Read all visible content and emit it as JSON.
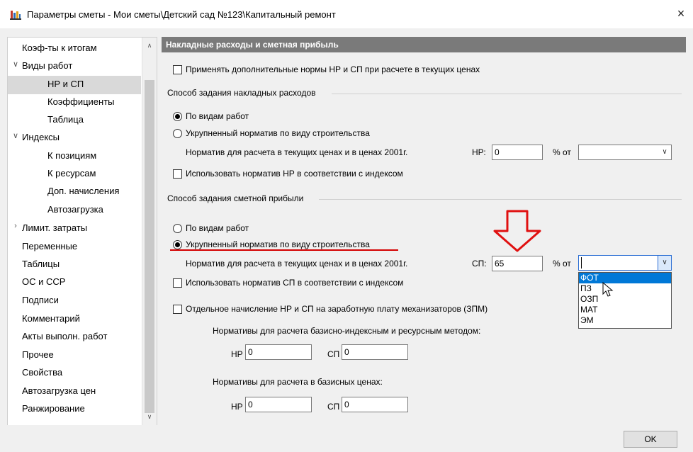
{
  "window": {
    "title": "Параметры сметы - Мои сметы\\Детский сад №123\\Капитальный ремонт",
    "close_glyph": "×"
  },
  "sidebar": {
    "items": [
      {
        "label": "Коэф-ты к итогам",
        "level": 0,
        "arrow": ""
      },
      {
        "label": "Виды работ",
        "level": 0,
        "arrow": "expanded"
      },
      {
        "label": "НР и СП",
        "level": 1,
        "arrow": "",
        "selected": true
      },
      {
        "label": "Коэффициенты",
        "level": 1,
        "arrow": ""
      },
      {
        "label": "Таблица",
        "level": 1,
        "arrow": ""
      },
      {
        "label": "Индексы",
        "level": 0,
        "arrow": "expanded"
      },
      {
        "label": "К позициям",
        "level": 1,
        "arrow": ""
      },
      {
        "label": "К ресурсам",
        "level": 1,
        "arrow": ""
      },
      {
        "label": "Доп. начисления",
        "level": 1,
        "arrow": ""
      },
      {
        "label": "Автозагрузка",
        "level": 1,
        "arrow": ""
      },
      {
        "label": "Лимит. затраты",
        "level": 0,
        "arrow": "collapsed"
      },
      {
        "label": "Переменные",
        "level": 0,
        "arrow": ""
      },
      {
        "label": "Таблицы",
        "level": 0,
        "arrow": ""
      },
      {
        "label": "ОС и ССР",
        "level": 0,
        "arrow": ""
      },
      {
        "label": "Подписи",
        "level": 0,
        "arrow": ""
      },
      {
        "label": "Комментарий",
        "level": 0,
        "arrow": ""
      },
      {
        "label": "Акты выполн. работ",
        "level": 0,
        "arrow": ""
      },
      {
        "label": "Прочее",
        "level": 0,
        "arrow": ""
      },
      {
        "label": "Свойства",
        "level": 0,
        "arrow": ""
      },
      {
        "label": "Автозагрузка цен",
        "level": 0,
        "arrow": ""
      },
      {
        "label": "Ранжирование",
        "level": 0,
        "arrow": ""
      }
    ],
    "scroll_up_glyph": "^",
    "scroll_down_glyph": "v"
  },
  "panel": {
    "header": "Накладные расходы и сметная прибыль",
    "apply_additional_norms": {
      "label": "Применять дополнительные нормы НР и СП при расчете в текущих ценах",
      "checked": false
    },
    "overhead_group": {
      "title": "Способ задания накладных расходов",
      "radio_by_work_types": {
        "label": "По видам работ",
        "selected": true
      },
      "radio_aggregated": {
        "label": "Укрупненный норматив по виду строительства",
        "selected": false
      },
      "norm_label": "Норматив для расчета в текущих ценах и в ценах 2001г.",
      "hr_label": "НР:",
      "hr_value": "0",
      "percent_of_label": "% от",
      "percent_of_value": "",
      "use_index_norm": {
        "label": "Использовать норматив НР в соответствии с индексом",
        "checked": false
      }
    },
    "profit_group": {
      "title": "Способ задания сметной прибыли",
      "radio_by_work_types": {
        "label": "По видам работ",
        "selected": false
      },
      "radio_aggregated": {
        "label": "Укрупненный норматив по виду строительства",
        "selected": true
      },
      "norm_label": "Норматив для расчета в текущих ценах и в ценах 2001г.",
      "sp_label": "СП:",
      "sp_value": "65",
      "percent_of_label": "% от",
      "percent_of_value": "",
      "dropdown_options": [
        "ФОТ",
        "ПЗ",
        "ОЗП",
        "МАТ",
        "ЭМ"
      ],
      "dropdown_selected": "ФОТ",
      "use_index_norm": {
        "label": "Использовать норматив СП в соответствии с индексом",
        "checked": false
      }
    },
    "separate_charge": {
      "label": "Отдельное начисление НР и СП на заработную плату механизаторов (ЗПМ)",
      "checked": false
    },
    "base_index_norms": {
      "title": "Нормативы для расчета базисно-индексным и ресурсным методом:",
      "hr_label": "НР",
      "hr_value": "0",
      "sp_label": "СП",
      "sp_value": "0"
    },
    "base_price_norms": {
      "title": "Нормативы для расчета в базисных ценах:",
      "hr_label": "НР",
      "hr_value": "0",
      "sp_label": "СП",
      "sp_value": "0"
    }
  },
  "footer": {
    "ok_label": "OK"
  },
  "colors": {
    "header_bg": "#7a7a7a",
    "selection": "#0078d7",
    "annotation_red": "#d40000"
  }
}
